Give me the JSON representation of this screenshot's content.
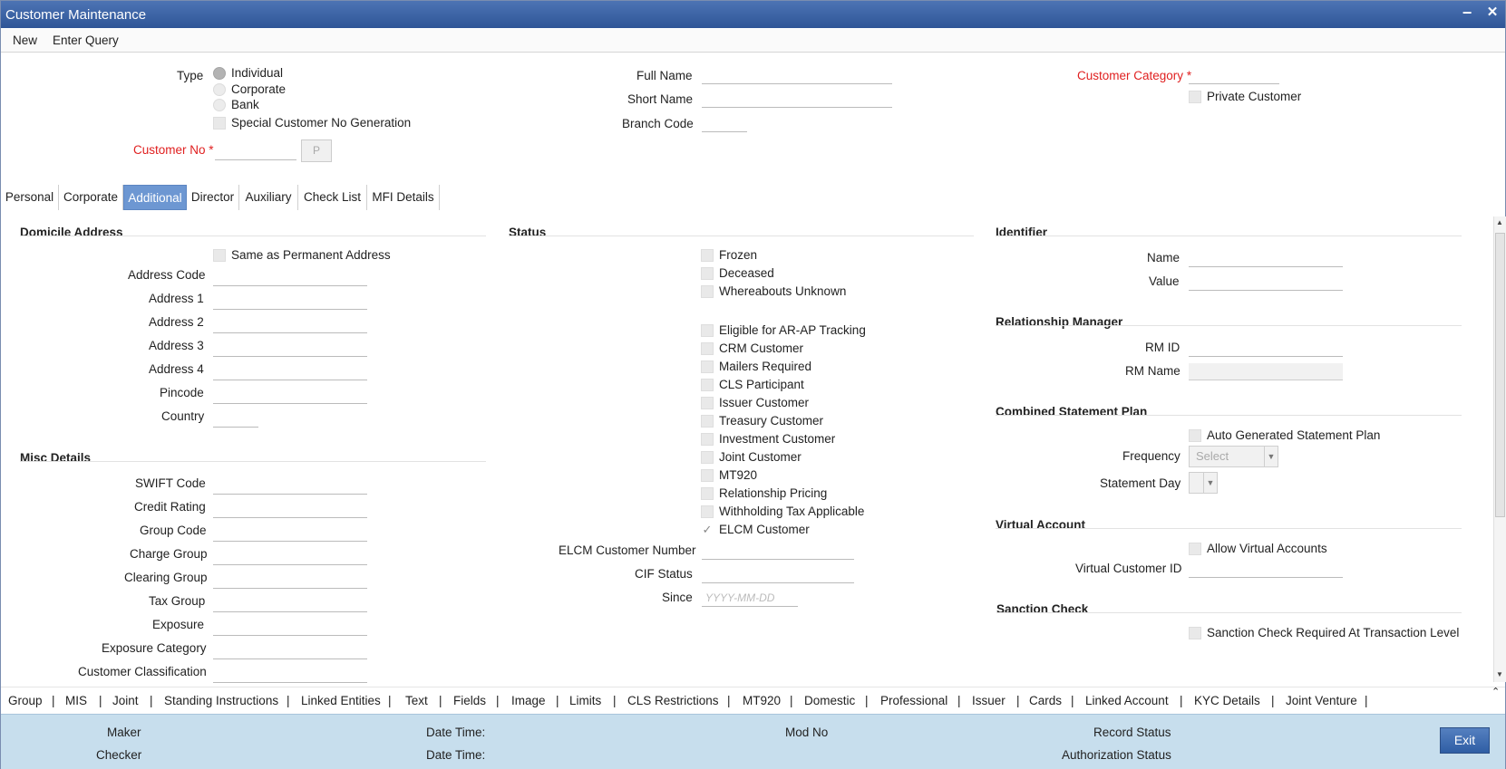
{
  "window": {
    "title": "Customer Maintenance",
    "minimize": "−",
    "close": "✕"
  },
  "menu": {
    "new": "New",
    "enter_query": "Enter Query"
  },
  "header": {
    "type_label": "Type",
    "type_options": [
      "Individual",
      "Corporate",
      "Bank"
    ],
    "special_no_gen": "Special Customer No Generation",
    "customer_no_label": "Customer No",
    "required_mark": "*",
    "p_button": "P",
    "full_name_label": "Full Name",
    "short_name_label": "Short Name",
    "branch_code_label": "Branch Code",
    "customer_category_label": "Customer Category",
    "private_customer": "Private Customer"
  },
  "tabs": [
    "Personal",
    "Corporate",
    "Additional",
    "Director",
    "Auxiliary",
    "Check List",
    "MFI Details"
  ],
  "active_tab": "Additional",
  "domicile": {
    "title": "Domicile Address",
    "same_as_permanent": "Same as Permanent Address",
    "fields": [
      "Address Code",
      "Address 1",
      "Address 2",
      "Address 3",
      "Address 4",
      "Pincode",
      "Country"
    ]
  },
  "misc": {
    "title": "Misc Details",
    "fields": [
      "SWIFT Code",
      "Credit Rating",
      "Group Code",
      "Charge Group",
      "Clearing Group",
      "Tax Group",
      "Exposure",
      "Exposure Category",
      "Customer Classification"
    ]
  },
  "status": {
    "title": "Status",
    "group1": [
      "Frozen",
      "Deceased",
      "Whereabouts Unknown"
    ],
    "group2": [
      "Eligible for AR-AP Tracking",
      "CRM Customer",
      "Mailers Required",
      "CLS Participant",
      "Issuer Customer",
      "Treasury Customer",
      "Investment Customer",
      "Joint Customer",
      "MT920",
      "Relationship Pricing",
      "Withholding Tax Applicable",
      "ELCM Customer"
    ],
    "elcm_number_label": "ELCM Customer Number",
    "cif_status_label": "CIF Status",
    "since_label": "Since",
    "since_placeholder": "YYYY-MM-DD"
  },
  "identifier": {
    "title": "Identifier",
    "name_label": "Name",
    "value_label": "Value"
  },
  "rm": {
    "title": "Relationship Manager",
    "rm_id_label": "RM ID",
    "rm_name_label": "RM Name"
  },
  "csp": {
    "title": "Combined Statement Plan",
    "auto_generated": "Auto Generated Statement Plan",
    "frequency_label": "Frequency",
    "frequency_value": "Select",
    "statement_day_label": "Statement Day"
  },
  "virtual": {
    "title": "Virtual Account",
    "allow": "Allow Virtual Accounts",
    "vcid_label": "Virtual Customer ID"
  },
  "sanction": {
    "title": "Sanction Check",
    "required": "Sanction Check Required At Transaction Level"
  },
  "bottom_links": [
    "Group",
    "MIS",
    "Joint",
    "Standing Instructions",
    "Linked Entities",
    "Text",
    "Fields",
    "Image",
    "Limits",
    "CLS Restrictions",
    "MT920",
    "Domestic",
    "Professional",
    "Issuer",
    "Cards",
    "Linked Account",
    "KYC Details",
    "Joint Venture"
  ],
  "separator": "|",
  "footer": {
    "maker": "Maker",
    "checker": "Checker",
    "date_time": "Date Time:",
    "mod_no": "Mod No",
    "record_status": "Record Status",
    "authorization_status": "Authorization Status",
    "exit": "Exit"
  }
}
